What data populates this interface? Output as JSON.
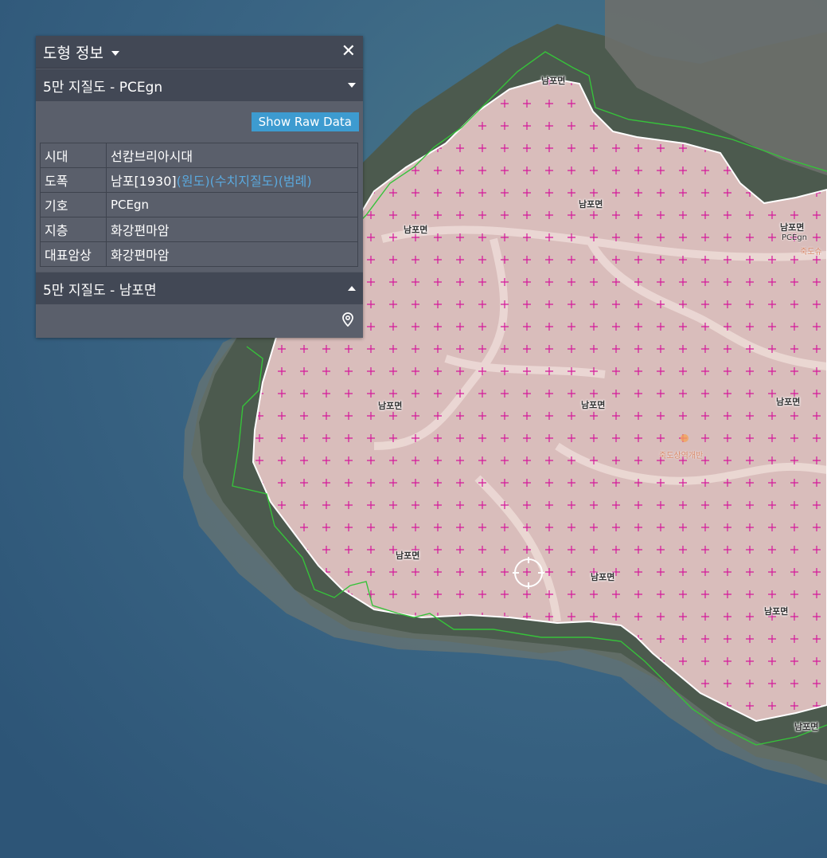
{
  "panel": {
    "title": "도형 정보",
    "section1": {
      "title": "5만 지질도 - PCEgn",
      "raw_button": "Show Raw Data",
      "rows": [
        {
          "key": "시대",
          "value": "선캄브리아시대"
        },
        {
          "key": "도폭",
          "value": "남포[1930]",
          "links": [
            "(원도)",
            "(수치지질도)",
            "(범례)"
          ]
        },
        {
          "key": "기호",
          "value": "PCEgn"
        },
        {
          "key": "지층",
          "value": "화강편마암"
        },
        {
          "key": "대표암상",
          "value": "화강편마암"
        }
      ]
    },
    "section2": {
      "title": "5만 지질도 - 남포면"
    }
  },
  "map": {
    "place_labels": [
      "남포면",
      "남포면",
      "남포면",
      "남포면",
      "남포면",
      "남포면",
      "남포면",
      "남포면",
      "남포면",
      "남포면",
      "남포면"
    ],
    "unit_label": "PCEgn",
    "poi_label": "죽도상역개반",
    "poi_label_2": "죽도슈",
    "colors": {
      "sea": "#2f5878",
      "polygon_fill": "#f2cfcf",
      "cross": "#d4179a",
      "outline": "#ffffff",
      "boundary": "#36c23a"
    }
  }
}
